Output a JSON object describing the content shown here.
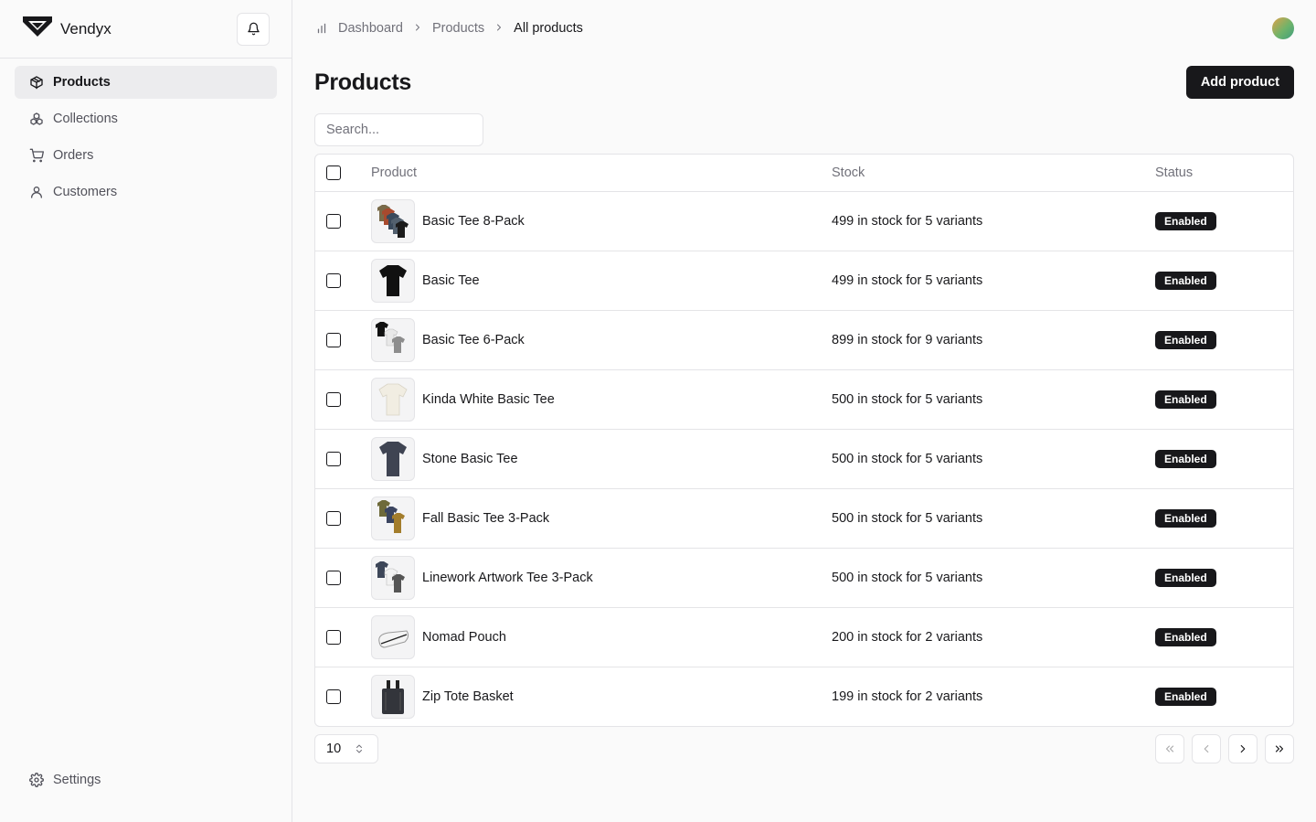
{
  "app": {
    "name": "Vendyx"
  },
  "sidebar": {
    "items": [
      {
        "label": "Products",
        "icon": "package-icon",
        "active": true
      },
      {
        "label": "Collections",
        "icon": "collections-icon",
        "active": false
      },
      {
        "label": "Orders",
        "icon": "cart-icon",
        "active": false
      },
      {
        "label": "Customers",
        "icon": "user-icon",
        "active": false
      }
    ],
    "settings_label": "Settings"
  },
  "breadcrumb": {
    "items": [
      "Dashboard",
      "Products",
      "All products"
    ]
  },
  "page": {
    "title": "Products",
    "add_button": "Add product"
  },
  "search": {
    "placeholder": "Search..."
  },
  "table": {
    "headers": {
      "product": "Product",
      "stock": "Stock",
      "status": "Status"
    },
    "rows": [
      {
        "name": "Basic Tee 8-Pack",
        "stock": "499 in stock for 5 variants",
        "status": "Enabled",
        "thumb": "multi-tee"
      },
      {
        "name": "Basic Tee",
        "stock": "499 in stock for 5 variants",
        "status": "Enabled",
        "thumb": "black-tee"
      },
      {
        "name": "Basic Tee 6-Pack",
        "stock": "899 in stock for 9 variants",
        "status": "Enabled",
        "thumb": "mono-tee"
      },
      {
        "name": "Kinda White Basic Tee",
        "stock": "500 in stock for 5 variants",
        "status": "Enabled",
        "thumb": "white-tee"
      },
      {
        "name": "Stone Basic Tee",
        "stock": "500 in stock for 5 variants",
        "status": "Enabled",
        "thumb": "stone-tee"
      },
      {
        "name": "Fall Basic Tee 3-Pack",
        "stock": "500 in stock for 5 variants",
        "status": "Enabled",
        "thumb": "fall-tee"
      },
      {
        "name": "Linework Artwork Tee 3-Pack",
        "stock": "500 in stock for 5 variants",
        "status": "Enabled",
        "thumb": "linework-tee"
      },
      {
        "name": "Nomad Pouch",
        "stock": "200 in stock for 2 variants",
        "status": "Enabled",
        "thumb": "pouch"
      },
      {
        "name": "Zip Tote Basket",
        "stock": "199 in stock for 2 variants",
        "status": "Enabled",
        "thumb": "tote"
      }
    ]
  },
  "pagination": {
    "page_size": "10"
  },
  "colors": {
    "primary": "#18181b",
    "border": "#e4e4e7",
    "muted": "#71717a",
    "bg": "#fafafa"
  }
}
